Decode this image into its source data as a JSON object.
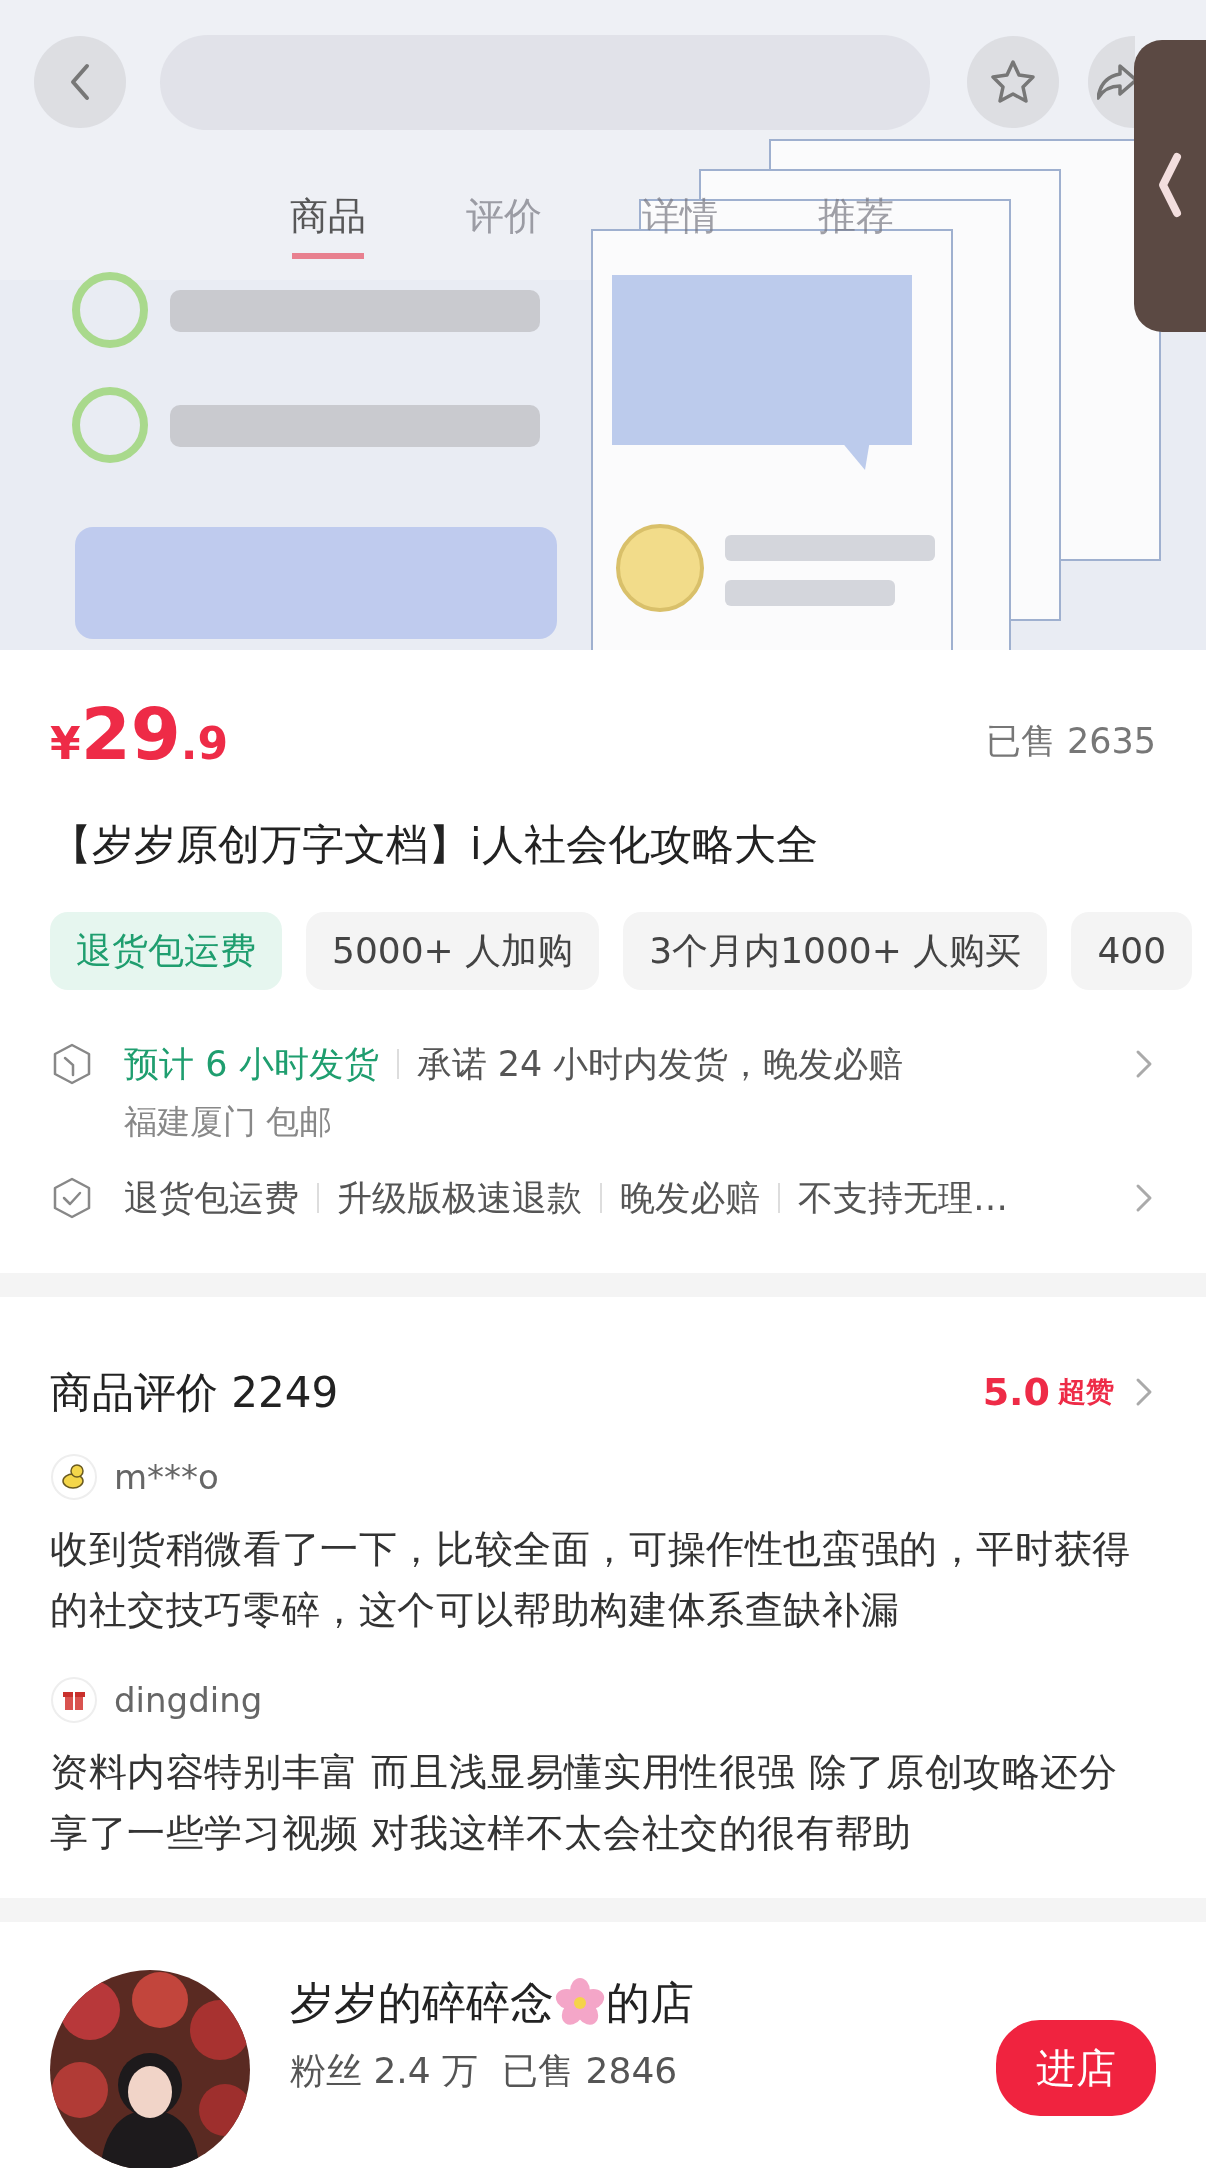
{
  "header": {
    "tabs": [
      {
        "label": "商品",
        "selected": true
      },
      {
        "label": "评价",
        "selected": false
      },
      {
        "label": "详情",
        "selected": false
      },
      {
        "label": "推荐",
        "selected": false
      }
    ]
  },
  "product": {
    "price": {
      "currency": "¥",
      "integer": "29",
      "decimal": ".9"
    },
    "sold": "已售 2635",
    "title": "【岁岁原创万字文档】i人社会化攻略大全",
    "tags": [
      {
        "label": "退货包运费",
        "kind": "highlight"
      },
      {
        "label": "5000+ 人加购",
        "kind": "plain"
      },
      {
        "label": "3个月内1000+ 人购买",
        "kind": "plain"
      },
      {
        "label": "400",
        "kind": "plain"
      }
    ]
  },
  "shipping": {
    "estimate": "预计 6 小时发货",
    "promise": "承诺 24 小时内发货，晚发必赔",
    "origin": "福建厦门 包邮"
  },
  "guarantees": [
    "退货包运费",
    "升级版极速退款",
    "晚发必赔",
    "不支持无理…"
  ],
  "reviews": {
    "title": "商品评价 2249",
    "score": "5.0",
    "score_label": "超赞",
    "items": [
      {
        "user": "m***o",
        "kind": "duck",
        "text": "收到货稍微看了一下，比较全面，可操作性也蛮强的，平时获得的社交技巧零碎，这个可以帮助构建体系查缺补漏"
      },
      {
        "user": "dingding",
        "kind": "gift",
        "text": "资料内容特别丰富 而且浅显易懂实用性很强 除了原创攻略还分享了一些学习视频 对我这样不太会社交的很有帮助"
      }
    ]
  },
  "shop": {
    "name_start": "岁岁的碎碎念",
    "name_end": "的店",
    "stats": [
      "粉丝 2.4 万",
      "已售 2846"
    ],
    "button": "进店"
  }
}
